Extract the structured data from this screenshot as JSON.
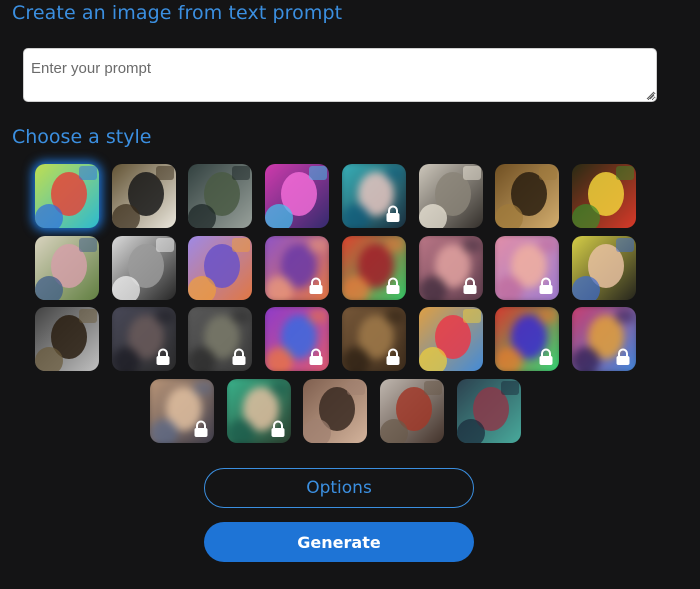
{
  "header": {
    "title": "Create an image from text prompt"
  },
  "prompt": {
    "placeholder": "Enter your prompt",
    "value": ""
  },
  "styles_section": {
    "title": "Choose a style"
  },
  "styles": [
    {
      "id": "abstract-paint",
      "locked": false,
      "selected": true,
      "colors": [
        "#c8e04a",
        "#24b8d6",
        "#e2463c",
        "#2f6ee0"
      ]
    },
    {
      "id": "panda",
      "locked": false,
      "selected": false,
      "colors": [
        "#5a4a2a",
        "#f2efe6",
        "#1a1a1a",
        "#3a2e1c"
      ]
    },
    {
      "id": "landscape",
      "locked": false,
      "selected": false,
      "colors": [
        "#2c3b3a",
        "#9ea6a0",
        "#4a5a44",
        "#1a2424"
      ]
    },
    {
      "id": "robot",
      "locked": false,
      "selected": false,
      "colors": [
        "#d93bb0",
        "#2a2a6a",
        "#f06bd6",
        "#41c6f0"
      ]
    },
    {
      "id": "woman-portrait",
      "locked": true,
      "selected": false,
      "colors": [
        "#3ab8c0",
        "#1a2a3a",
        "#e6c6c0",
        "#0e5a7a"
      ]
    },
    {
      "id": "vintage-engraving",
      "locked": false,
      "selected": false,
      "colors": [
        "#d6d0c4",
        "#2a2622",
        "#8a8478",
        "#efe9dc"
      ]
    },
    {
      "id": "mona-lisa",
      "locked": false,
      "selected": false,
      "colors": [
        "#6a4a1e",
        "#d8b272",
        "#2a1e10",
        "#a07a3a"
      ]
    },
    {
      "id": "flowers",
      "locked": false,
      "selected": false,
      "colors": [
        "#1e2a12",
        "#e23a2a",
        "#f0d03a",
        "#3a8a2a"
      ]
    },
    {
      "id": "ballet",
      "locked": false,
      "selected": false,
      "colors": [
        "#e0d8c6",
        "#5a7a3a",
        "#d4a0a8",
        "#3a5a8a"
      ]
    },
    {
      "id": "coffee-sketch",
      "locked": false,
      "selected": false,
      "colors": [
        "#e6e6e6",
        "#1a1a1a",
        "#9a9a9a",
        "#f6f6f6"
      ]
    },
    {
      "id": "isometric",
      "locked": false,
      "selected": false,
      "colors": [
        "#9a8af0",
        "#e4763a",
        "#6a52c8",
        "#f0a03a"
      ]
    },
    {
      "id": "fox",
      "locked": true,
      "selected": false,
      "colors": [
        "#8a52d0",
        "#e8783a",
        "#6a3aa6",
        "#f0a07a"
      ]
    },
    {
      "id": "neon-face",
      "locked": true,
      "selected": false,
      "colors": [
        "#e83a2a",
        "#2ad06a",
        "#a01e2a",
        "#f07a3a"
      ]
    },
    {
      "id": "woman-soft",
      "locked": true,
      "selected": false,
      "colors": [
        "#c07a8a",
        "#5a3a4a",
        "#e0a2a0",
        "#3a2a3a"
      ]
    },
    {
      "id": "pastel-abstract",
      "locked": true,
      "selected": false,
      "colors": [
        "#e690a6",
        "#9a7ad0",
        "#f0b0a0",
        "#c06a9a"
      ]
    },
    {
      "id": "pop-art",
      "locked": false,
      "selected": false,
      "colors": [
        "#e0d84a",
        "#1a1a1a",
        "#e6c0a0",
        "#3a6ad0"
      ]
    },
    {
      "id": "modern-house",
      "locked": false,
      "selected": false,
      "colors": [
        "#3a3a3a",
        "#c8c8c8",
        "#2a1e12",
        "#6a5a3a"
      ]
    },
    {
      "id": "blur-1",
      "locked": true,
      "selected": false,
      "colors": [
        "#4a4a5a",
        "#2a2a2a",
        "#6a5a5a",
        "#1a1a22"
      ]
    },
    {
      "id": "blur-2",
      "locked": true,
      "selected": false,
      "colors": [
        "#5a5a5a",
        "#3a3a3a",
        "#7a7a6a",
        "#2a2a2a"
      ]
    },
    {
      "id": "blur-3",
      "locked": true,
      "selected": false,
      "colors": [
        "#8a3ad0",
        "#e05a6a",
        "#3a6ae0",
        "#f07a3a"
      ]
    },
    {
      "id": "blur-4",
      "locked": true,
      "selected": false,
      "colors": [
        "#7a5a3a",
        "#3a2a1a",
        "#a07a4a",
        "#2a1e12"
      ]
    },
    {
      "id": "icons-grid",
      "locked": false,
      "selected": false,
      "colors": [
        "#e8a03a",
        "#3a8ae0",
        "#e83a4a",
        "#f0d03a"
      ]
    },
    {
      "id": "green-red-abstract",
      "locked": true,
      "selected": false,
      "colors": [
        "#e0302a",
        "#2ae07a",
        "#3a2ad0",
        "#f07a2a"
      ]
    },
    {
      "id": "colorful-face",
      "locked": true,
      "selected": false,
      "colors": [
        "#d03a6a",
        "#3a8ae0",
        "#e0a03a",
        "#2a1a4a"
      ]
    },
    {
      "id": "warrior-woman",
      "locked": true,
      "selected": false,
      "colors": [
        "#c09a7a",
        "#3a3a4a",
        "#e0c0a0",
        "#5a6a8a"
      ]
    },
    {
      "id": "teal-portrait",
      "locked": true,
      "selected": false,
      "colors": [
        "#3ab890",
        "#2a3a2a",
        "#e0c0a0",
        "#1a5a4a"
      ]
    },
    {
      "id": "renaissance-woman",
      "locked": false,
      "selected": false,
      "colors": [
        "#7a5a4a",
        "#d8b8a0",
        "#3a2a22",
        "#a08070"
      ]
    },
    {
      "id": "pirate",
      "locked": false,
      "selected": false,
      "colors": [
        "#c8c0b8",
        "#3a2a22",
        "#a03a2a",
        "#6a5a4a"
      ]
    },
    {
      "id": "green-man",
      "locked": false,
      "selected": false,
      "colors": [
        "#2a3a4a",
        "#4ab0a0",
        "#8a3a4a",
        "#1a2a3a"
      ]
    }
  ],
  "buttons": {
    "options": "Options",
    "generate": "Generate"
  },
  "theme": {
    "accent": "#3b8fe0",
    "primary": "#1e74d6",
    "background": "#141415"
  }
}
